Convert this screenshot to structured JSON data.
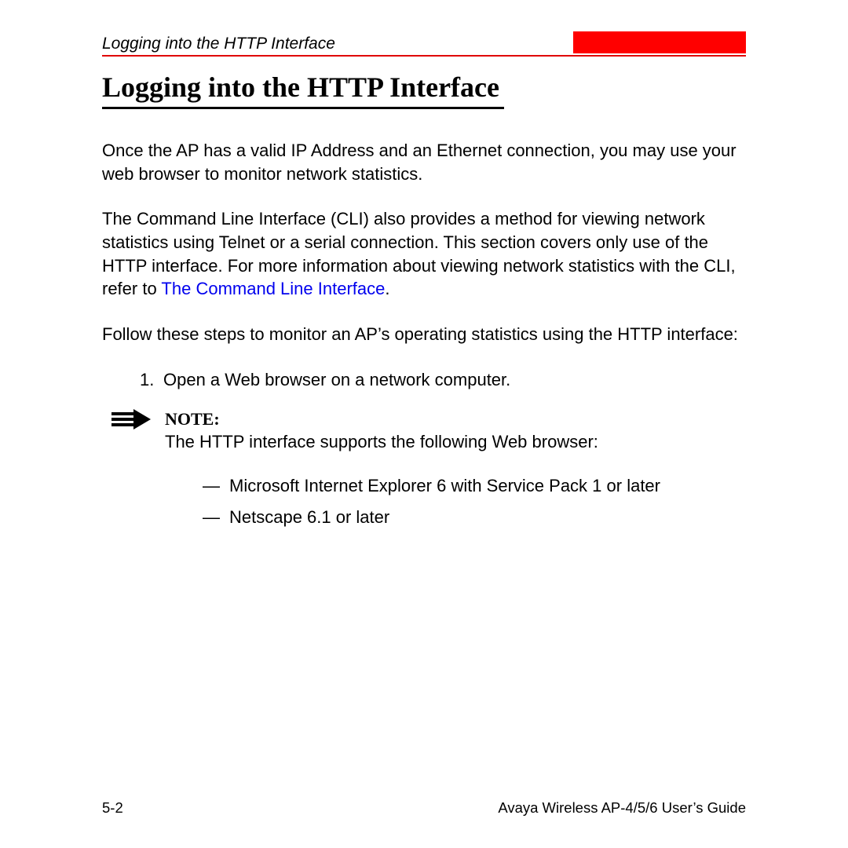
{
  "header": {
    "running_title": "Logging into the HTTP Interface"
  },
  "title": "Logging into the HTTP Interface",
  "paragraphs": {
    "p1": "Once the AP has a valid IP Address and an Ethernet connection, you may use your web browser to monitor network statistics.",
    "p2a": "The Command Line Interface (CLI) also provides a method for viewing network statistics using Telnet or a serial connection. This section covers only use of the HTTP interface. For more information about viewing network statistics with the CLI, refer to ",
    "p2_link": "The Command Line Interface",
    "p2b": ".",
    "p3": "Follow these steps to monitor an AP’s operating statistics using the HTTP interface:"
  },
  "steps": {
    "s1_num": "1.",
    "s1_text": "Open a Web browser on a network computer."
  },
  "note": {
    "label": "NOTE:",
    "text": "The HTTP interface supports the following Web browser:",
    "items": {
      "i1": "Microsoft Internet Explorer 6 with Service Pack 1 or later",
      "i2": "Netscape 6.1 or later"
    }
  },
  "footer": {
    "page_num": "5-2",
    "book": "Avaya Wireless AP-4/5/6 User’s Guide"
  }
}
